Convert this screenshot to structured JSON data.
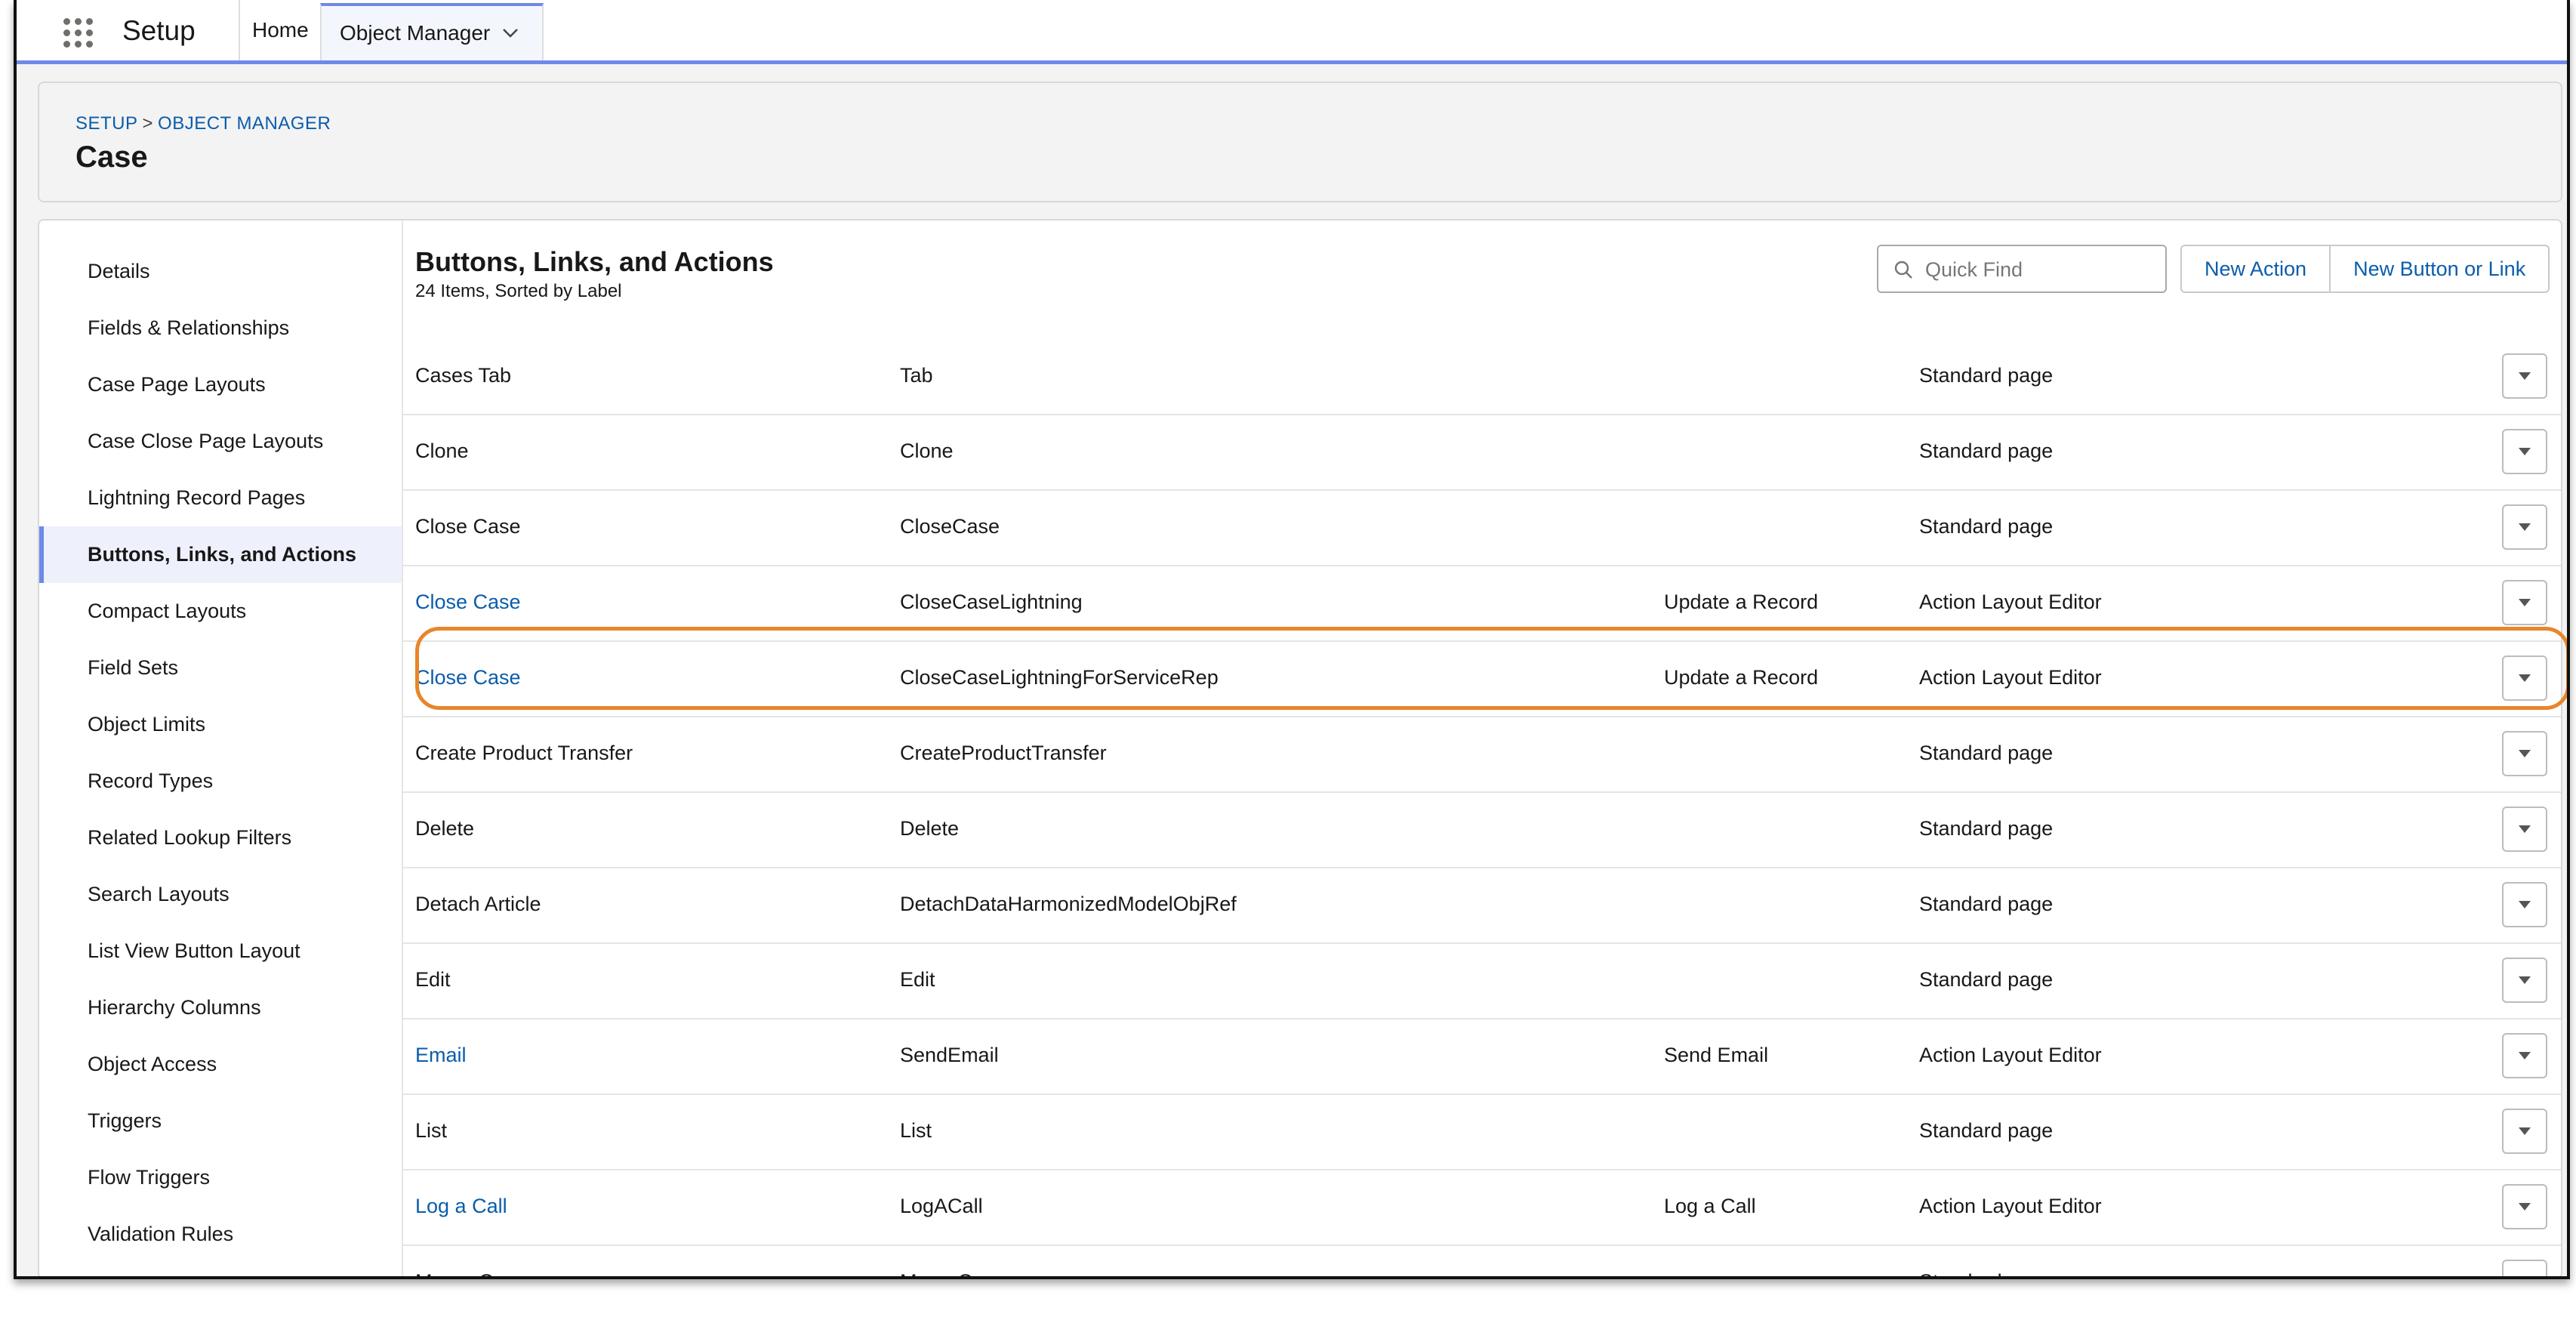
{
  "topnav": {
    "app_name": "Setup",
    "home_label": "Home",
    "active_tab_label": "Object Manager"
  },
  "header": {
    "breadcrumb_setup": "SETUP",
    "breadcrumb_separator": ">",
    "breadcrumb_object_manager": "OBJECT MANAGER",
    "title": "Case"
  },
  "sidebar": {
    "items": [
      {
        "label": "Details"
      },
      {
        "label": "Fields & Relationships"
      },
      {
        "label": "Case Page Layouts"
      },
      {
        "label": "Case Close Page Layouts"
      },
      {
        "label": "Lightning Record Pages"
      },
      {
        "label": "Buttons, Links, and Actions",
        "active": true
      },
      {
        "label": "Compact Layouts"
      },
      {
        "label": "Field Sets"
      },
      {
        "label": "Object Limits"
      },
      {
        "label": "Record Types"
      },
      {
        "label": "Related Lookup Filters"
      },
      {
        "label": "Search Layouts"
      },
      {
        "label": "List View Button Layout"
      },
      {
        "label": "Hierarchy Columns"
      },
      {
        "label": "Object Access"
      },
      {
        "label": "Triggers"
      },
      {
        "label": "Flow Triggers"
      },
      {
        "label": "Validation Rules"
      }
    ]
  },
  "section": {
    "title": "Buttons, Links, and Actions",
    "subtitle": "24 Items, Sorted by Label",
    "quick_find_placeholder": "Quick Find",
    "new_action_label": "New Action",
    "new_button_label": "New Button or Link"
  },
  "rows": [
    {
      "label": "Cases Tab",
      "name": "Tab",
      "type": "",
      "override": "Standard page",
      "link": false
    },
    {
      "label": "Clone",
      "name": "Clone",
      "type": "",
      "override": "Standard page",
      "link": false
    },
    {
      "label": "Close Case",
      "name": "CloseCase",
      "type": "",
      "override": "Standard page",
      "link": false
    },
    {
      "label": "Close Case",
      "name": "CloseCaseLightning",
      "type": "Update a Record",
      "override": "Action Layout Editor",
      "link": true
    },
    {
      "label": "Close Case",
      "name": "CloseCaseLightningForServiceRep",
      "type": "Update a Record",
      "override": "Action Layout Editor",
      "link": true
    },
    {
      "label": "Create Product Transfer",
      "name": "CreateProductTransfer",
      "type": "",
      "override": "Standard page",
      "link": false
    },
    {
      "label": "Delete",
      "name": "Delete",
      "type": "",
      "override": "Standard page",
      "link": false
    },
    {
      "label": "Detach Article",
      "name": "DetachDataHarmonizedModelObjRef",
      "type": "",
      "override": "Standard page",
      "link": false
    },
    {
      "label": "Edit",
      "name": "Edit",
      "type": "",
      "override": "Standard page",
      "link": false
    },
    {
      "label": "Email",
      "name": "SendEmail",
      "type": "Send Email",
      "override": "Action Layout Editor",
      "link": true
    },
    {
      "label": "List",
      "name": "List",
      "type": "",
      "override": "Standard page",
      "link": false
    },
    {
      "label": "Log a Call",
      "name": "LogACall",
      "type": "Log a Call",
      "override": "Action Layout Editor",
      "link": true
    },
    {
      "label": "Merge Cases",
      "name": "MergeCase",
      "type": "",
      "override": "Standard page",
      "link": false
    }
  ],
  "colors": {
    "link": "#0b5cab",
    "accent": "#6e89e8",
    "highlight": "#e8862a"
  }
}
